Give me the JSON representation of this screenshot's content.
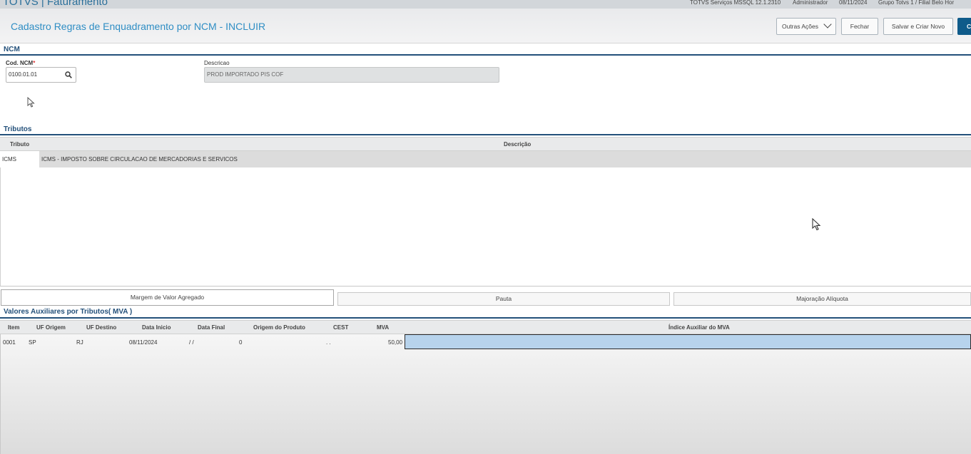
{
  "app": {
    "title": "TOTVS | Faturamento",
    "environment": "TOTVS Serviços MSSQL 12.1.2310",
    "user": "Administrador",
    "date": "08/11/2024",
    "company": "Grupo Totvs 1 / Filial Belo Hor"
  },
  "header": {
    "title": "Cadastro Regras de Enquadramento por NCM - INCLUIR",
    "actions": {
      "outras_acoes": "Outras Ações",
      "fechar": "Fechar",
      "salvar_criar_novo": "Salvar e Criar Novo",
      "confirmar": "C"
    }
  },
  "ncm": {
    "section_title": "NCM",
    "cod_label": "Cod. NCM",
    "required_mark": "*",
    "cod_value": "0100.01.01",
    "desc_label": "Descricao",
    "desc_value": "PROD IMPORTADO PIS COF"
  },
  "tributos": {
    "section_title": "Tributos",
    "columns": [
      "Tributo",
      "Descrição"
    ],
    "rows": [
      {
        "tributo": "ICMS",
        "descricao": "ICMS - IMPOSTO SOBRE CIRCULACAO DE MERCADORIAS E SERVICOS"
      }
    ]
  },
  "tabs": [
    "Margem de Valor Agregado",
    "Pauta",
    "Majoração Alíquota"
  ],
  "mva": {
    "section_title": "Valores Auxiliares por Tributos( MVA )",
    "columns": [
      "Item",
      "UF Origem",
      "UF Destino",
      "Data Inicio",
      "Data Final",
      "Origem do Produto",
      "CEST",
      "MVA",
      "Índice Auxiliar do MVA"
    ],
    "rows": [
      {
        "item": "0001",
        "uf_origem": "SP",
        "uf_destino": "RJ",
        "data_inicio": "08/11/2024",
        "data_final": "/ /",
        "origem_produto": "0",
        "cest": ". .",
        "mva": "50,00",
        "indice_auxiliar": ""
      }
    ]
  },
  "colors": {
    "accent": "#2f8ec4",
    "section": "#23507a",
    "primary_button": "#0f5b8a",
    "selected_cell": "#b7d3ec"
  }
}
